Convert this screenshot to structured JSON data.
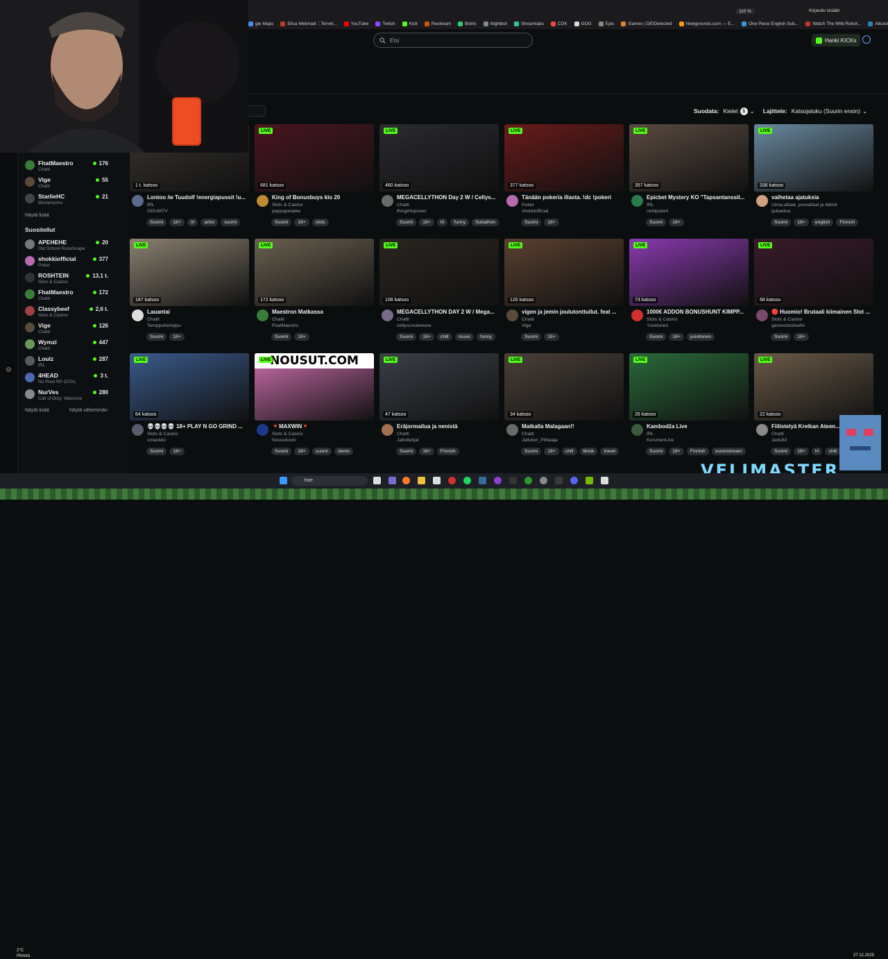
{
  "browser": {
    "zoom": "110 %",
    "login": "Kirjaudu sisään",
    "bookmarks": [
      "gle Maps",
      "Elisa Webmail :: Tervet...",
      "YouTube",
      "Twitch",
      "Kick",
      "Restream",
      "Botrix",
      "Nightbot",
      "Streamlabs",
      "CDK",
      "GOG",
      "Epic",
      "Games | DEIDetected",
      "Newgrounds.com — E...",
      "One Piece English Sub...",
      "Watch The Wild Robot...",
      "Aikuisten sosiaalipalve...",
      "Muut kirjanmerkit"
    ]
  },
  "header": {
    "search_placeholder": "Etsi",
    "kicks_button": "Hanki KICKs"
  },
  "filters": {
    "filter_label": "Suodata:",
    "languages_label": "Kielet",
    "languages_count": "1",
    "sort_label": "Lajittele:",
    "sort_value": "Katsojaluku (Suurin ensin)"
  },
  "sidebar": {
    "followed": [
      {
        "name": "FhatMaestro",
        "category": "Chatti",
        "count": "176",
        "color": "#3a7d3a"
      },
      {
        "name": "Vige",
        "category": "Chatti",
        "count": "55",
        "color": "#5a4a3a"
      },
      {
        "name": "StarlieHC",
        "category": "Movierooms",
        "count": "21",
        "color": "#444"
      }
    ],
    "show_more_1": "Näytä lisää",
    "recommended_heading": "Suositellut",
    "recommended": [
      {
        "name": "APEHEHE",
        "category": "Old School RuneScape",
        "count": "20",
        "color": "#777"
      },
      {
        "name": "shokkiofficial",
        "category": "Poker",
        "count": "377",
        "color": "#b86ab0"
      },
      {
        "name": "ROSHTEIN",
        "category": "Slots & Casino",
        "count": "13,1 t.",
        "color": "#333"
      },
      {
        "name": "FhatMaestro",
        "category": "Chatti",
        "count": "172",
        "color": "#3a7d3a"
      },
      {
        "name": "Classybeef",
        "category": "Slots & Casino",
        "count": "2,6 t.",
        "color": "#a04040"
      },
      {
        "name": "Vige",
        "category": "Chatti",
        "count": "126",
        "color": "#5a4a3a"
      },
      {
        "name": "Wymzi",
        "category": "Chatti",
        "count": "447",
        "color": "#6a9a5a"
      },
      {
        "name": "Loulz",
        "category": "IRL",
        "count": "287",
        "color": "#5a5a5a"
      },
      {
        "name": "4HEAD",
        "category": "No Pixel RP (GTA)",
        "count": "3 t.",
        "color": "#4a6ab0"
      },
      {
        "name": "NurVes",
        "category": "Call of Duty: Warzone",
        "count": "280",
        "color": "#888"
      }
    ],
    "show_more_2": "Näytä lisää",
    "show_less": "Näytä vähemmän"
  },
  "streams": [
    {
      "title": "Lontoo /w Tuudolf !energiapussit !u...",
      "category": "IRL",
      "user": "OGUMTV",
      "viewers": "1 t. katsoo",
      "tags": [
        "Suomi",
        "18+",
        "Irl",
        "artist",
        "suomi"
      ],
      "thumb": "#3a3530",
      "avatar": "#5a6a8a",
      "live": false
    },
    {
      "title": "King of Bonusbuys klo 20",
      "category": "Slots & Casino",
      "user": "pappapetalee",
      "viewers": "681 katsoo",
      "tags": [
        "Suomi",
        "18+",
        "slots"
      ],
      "thumb": "#4a1520",
      "avatar": "#c08a30",
      "live": true
    },
    {
      "title": "MEGACELLYTHON Day 2 W / Cellys...",
      "category": "Chatti",
      "user": "thisgirlispower",
      "viewers": "460 katsoo",
      "tags": [
        "Suomi",
        "18+",
        "Irl",
        "funny",
        "Subathon"
      ],
      "thumb": "#2a2a30",
      "avatar": "#6a6a6a",
      "live": true
    },
    {
      "title": "Tänään pokeria illasta. !dc !pokeri",
      "category": "Poker",
      "user": "shokkiofficial",
      "viewers": "377 katsoo",
      "tags": [
        "Suomi",
        "18+"
      ],
      "thumb": "#6a1a1a",
      "avatar": "#b86ab0",
      "live": true
    },
    {
      "title": "Epicbet Mystery KO \"Tapsantanssit...",
      "category": "IRL",
      "user": "nettipokeri",
      "viewers": "357 katsoo",
      "tags": [
        "Suomi",
        "18+"
      ],
      "thumb": "#5a4a40",
      "avatar": "#2a7a4a",
      "live": true
    },
    {
      "title": "vaihetaa ajatuksia",
      "category": "Uima-altaat, poreallaat ja bikinit",
      "user": "ijuliaelisa",
      "viewers": "336 katsoo",
      "tags": [
        "Suomi",
        "18+",
        "english",
        "Finnish"
      ],
      "thumb": "#6a8aa0",
      "avatar": "#d0a080",
      "live": true
    },
    {
      "title": "Lauantai",
      "category": "Chatti",
      "user": "Temppuhemppu",
      "viewers": "187 katsoo",
      "tags": [
        "Suomi",
        "18+"
      ],
      "thumb": "#8a8070",
      "avatar": "#dddddd",
      "live": true
    },
    {
      "title": "Maestron Matkassa",
      "category": "Chatti",
      "user": "FhatMaestro",
      "viewers": "172 katsoo",
      "tags": [
        "Suomi",
        "18+"
      ],
      "thumb": "#6a6050",
      "avatar": "#3a7d3a",
      "live": true
    },
    {
      "title": "MEGACELLYTHON DAY 2 W / Mega...",
      "category": "Chatti",
      "user": "cellyscooterwow",
      "viewers": "108 katsoo",
      "tags": [
        "Suomi",
        "18+",
        "chill",
        "music",
        "funny"
      ],
      "thumb": "#2a2520",
      "avatar": "#7a6a8a",
      "live": true
    },
    {
      "title": "vigen ja jemin joulutonttuilut. feat ...",
      "category": "Chatti",
      "user": "Vige",
      "viewers": "126 katsoo",
      "tags": [
        "Suomi",
        "18+"
      ],
      "thumb": "#5a4030",
      "avatar": "#5a4a3a",
      "live": true
    },
    {
      "title": "1000€ ADDON BONUSHUNT KIMPP...",
      "category": "Slots & Casino",
      "user": "Ysivitonen",
      "viewers": "73 katsoo",
      "tags": [
        "Suomi",
        "18+",
        "ysivitonen"
      ],
      "thumb": "#8a3ab0",
      "avatar": "#d03030",
      "live": true
    },
    {
      "title": "🔴 Huomio! Brutaali kiimainen Slot ...",
      "category": "Slots & Casino",
      "user": "gameslotslivefin",
      "viewers": "68 katsoo",
      "tags": [
        "Suomi",
        "18+"
      ],
      "thumb": "#3a1a2a",
      "avatar": "#7a4a6a",
      "live": true
    },
    {
      "title": "💀💀💀💀 18+ PLAY N GO GRIND ...",
      "category": "Slots & Casino",
      "user": "smauletz",
      "viewers": "64 katsoo",
      "tags": [
        "Suomi",
        "18+"
      ],
      "thumb": "#3a5a8a",
      "avatar": "#5a5a6a",
      "live": true
    },
    {
      "title": "🔻MAXWIN🔻",
      "category": "Slots & Casino",
      "user": "Nousutcom",
      "viewers": "",
      "tags": [
        "Suomi",
        "18+",
        "suomi",
        "demo"
      ],
      "thumb": "#d070b0",
      "avatar": "#1a3a8a",
      "live": true,
      "banner": "NOUSUT.COM"
    },
    {
      "title": "Eräjormailua ja nenistä",
      "category": "Chatti",
      "user": "Jalluttelijat",
      "viewers": "47 katsoo",
      "tags": [
        "Suomi",
        "18+",
        "Finnish"
      ],
      "thumb": "#3a4048",
      "avatar": "#a07050",
      "live": true
    },
    {
      "title": "Matkalla Malagaan!!",
      "category": "Chatti",
      "user": "Jalluton_Pihtaaja",
      "viewers": "34 katsoo",
      "tags": [
        "Suomi",
        "18+",
        "chill",
        "tiktok",
        "travel"
      ],
      "thumb": "#4a4038",
      "avatar": "#6a6a6a",
      "live": true
    },
    {
      "title": "Kambodža Live",
      "category": "IRL",
      "user": "KurvinenLive",
      "viewers": "26 katsoo",
      "tags": [
        "Suomi",
        "18+",
        "Finnish",
        "suomistream"
      ],
      "thumb": "#2a6a3a",
      "avatar": "#3a5a3a",
      "live": true
    },
    {
      "title": "Fiilistelyä Kreikan Ateen...",
      "category": "Chatti",
      "user": "Jedu92",
      "viewers": "22 katsoo",
      "tags": [
        "Suomi",
        "18+",
        "Irl",
        "chill"
      ],
      "thumb": "#6a5a48",
      "avatar": "#8a8a8a",
      "live": true
    }
  ],
  "taskbar": {
    "search": "Hae",
    "temp": "2°C",
    "weather": "Pilvistä",
    "date": "27.12.2025"
  },
  "overlay": {
    "logo": "VELIMASTER"
  }
}
